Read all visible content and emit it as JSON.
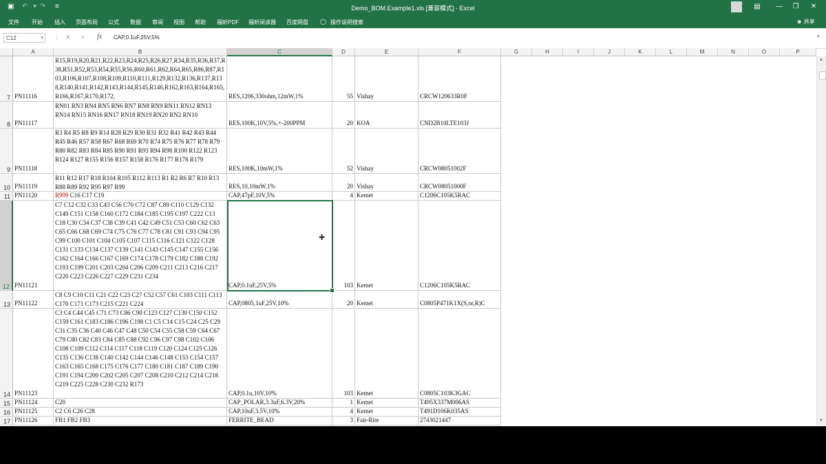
{
  "titlebar": {
    "title": "Demo_BOM.Example1.xls [兼容模式] - Excel",
    "save_icon": "save-icon",
    "undo_icon": "undo-icon",
    "redo_icon": "redo-icon",
    "customize_icon": "customize-icon"
  },
  "ribbon": {
    "tabs": [
      "文件",
      "开始",
      "插入",
      "页面布局",
      "公式",
      "数据",
      "审阅",
      "视图",
      "帮助",
      "福昕PDF",
      "福昕阅读器",
      "百度网盘",
      "操作说明搜索"
    ],
    "share": "共享"
  },
  "formula_bar": {
    "name_box": "C12",
    "formula": "CAP,0.1uF,25V,5%"
  },
  "columns": [
    "A",
    "B",
    "C",
    "D",
    "E",
    "F",
    "G",
    "H",
    "I",
    "J",
    "K",
    "L",
    "M",
    "N",
    "O",
    "P"
  ],
  "rows": [
    {
      "num": "7",
      "a": "PN11116",
      "b": "R15,R19,R20,R21,R22,R23,R24,R25,R26,R27,R34,R35,R36,R37,R38,R51,R52,R53,R54,R55,R56,R60,R61,R62,R64,R65,R86,R87,R103,R106,R107,R108,R109,R110,R111,R129,R132,R136,R137,R138,R140,R141,R142,R143,R144,R145,R146,R162,R163,R164,R165,R166,R167,R170,R172,",
      "c": "RES,1206,330ohm,12mW,1%",
      "d": "55",
      "e": "Vishay",
      "f": "CRCW120633R0F"
    },
    {
      "num": "8",
      "a": "PN11117",
      "b": "RN01 RN3 RN4 RN5 RN6 RN7 RN8 RN9 RN11 RN12 RN13 RN14 RN15 RN16 RN17 RN18 RN19 RN20 RN2 RN10",
      "c": "RES,100K,10V,5%,+-200PPM",
      "d": "20",
      "e": "KOA",
      "f": "CND2B10LTE103J"
    },
    {
      "num": "9",
      "a": "PN11118",
      "b": "R3 R4 R5 R8 R9 R14 R28 R29 R30 R31 R32 R41 R42 R43 R44 R45 R46 R57 R58 R67 R68 R69 R70 R74 R75 R76 R77 R78 R79 R80 R82 R83 R84 R85 R90 R91 R93 R94 R98 R100 R122 R123 R124 R127 R155 R156 R157 R158 R176 R177 R178 R179",
      "c": "RES,100K,10mW,1%",
      "d": "52",
      "e": "Vishay",
      "f": "CRCW08051002F"
    },
    {
      "num": "10",
      "a": "PN11119",
      "b": "R11 R12 R17 R18 R104 R105 R112 R113 R1 R2 R6 R7 R10 R13 R88 R89 R92 R95 R97 R99",
      "c": "RES,10,10mW,1%",
      "d": "20",
      "e": "Vishay",
      "f": "CRCW08051000F"
    },
    {
      "num": "11",
      "a": "PN11120",
      "b_red": "R999",
      "b": " C16 C17 C19",
      "c": "CAP,47pF,10V,5%",
      "d": "4",
      "e": "Kemet",
      "f": "C1206C105K5RAC"
    },
    {
      "num": "12",
      "a": "PN11121",
      "b": "C7 C12 C32 C33 C43 C56 C70 C72 C87 C89 C110 C129 C132 C149 C151 C158 C160 C172 C184 C185 C195 C197 C222 C13 C18 C30 C34 C37 C38 C39 C41 C42 C49 C51 C53 C60 C62 C63 C65 C66 C68 C69 C74 C75 C76 C77 C78 C81 C91 C93 C94 C95 C99 C100 C101 C104 C105 C107 C115 C116 C121 C122 C128 C131 C133 C134 C137 C139 C141 C143 C145 C147 C155 C156 C162 C164 C166 C167 C169 C174 C178 C179 C182 C188 C192 C193 C199 C201 C203 C204 C206 C209 C211 C213 C216 C217 C220 C223 C226 C227 C229 C231 C234",
      "c": "CAP,0.1uF,25V,5%",
      "d": "103",
      "e": "Kemet",
      "f": "C1206C105K5RAC"
    },
    {
      "num": "13",
      "a": "PN11122",
      "b": "C8 C9 C10 C11 C21 C22 C23 C27 C52 C57 C61 C103 C111 C113 C170 C171 C173 C215 C221 C224",
      "c": "CAP,0805,1uF,25V,10%",
      "d": "20",
      "e": "Kemet",
      "f": "C0805P471K1X(S,or,R)C"
    },
    {
      "num": "14",
      "a": "PN11123",
      "b": "C3 C4 C44 C45 C71 C73 C86 C90 C123 C127 C130 C150 C152 C159 C161 C183 C186 C196 C198 C1 C5 C14 C15 C24 C25 C29 C31 C35 C36 C40 C46 C47 C48 C50 C54 C55 C58 C59 C64 C67 C79 C80 C82 C83 C84 C85 C88 C92 C96 C97 C98 C102 C106 C108 C109 C112 C114 C117 C118 C119 C120 C124 C125 C126 C135 C136 C138 C140 C142 C144 C146 C148 C153 C154 C157 C163 C165 C168 C175 C176 C177 C180 C181 C187 C189 C190 C191 C194 C200 C202 C205 C207 C208 C210 C212 C214 C218 C219 C225 C228 C230 C232 R173",
      "c": "CAP,0.1u,10V,10%",
      "d": "103",
      "e": "Kemet",
      "f": "C0805C103K3GAC"
    },
    {
      "num": "15",
      "a": "PN11124",
      "b": "C20",
      "c": "CAP_POLAR,3.3uF,6.3V,20%",
      "d": "1",
      "e": "Kemet",
      "f": "T495X337M006AS"
    },
    {
      "num": "16",
      "a": "PN11125",
      "b": "C2 C6 C26 C28",
      "c": "CAP,10uF,3.5V,10%",
      "d": "4",
      "e": "Kemet",
      "f": "T491D106K035AS"
    },
    {
      "num": "17",
      "a": "PN11126",
      "b": "FB1 FB2 FB3",
      "c": "FERRITE_BEAD",
      "d": "3",
      "e": "Fair-Rite",
      "f": "2743021447"
    }
  ],
  "colors": {
    "excel_green": "#217346",
    "error_red": "#c00000"
  }
}
